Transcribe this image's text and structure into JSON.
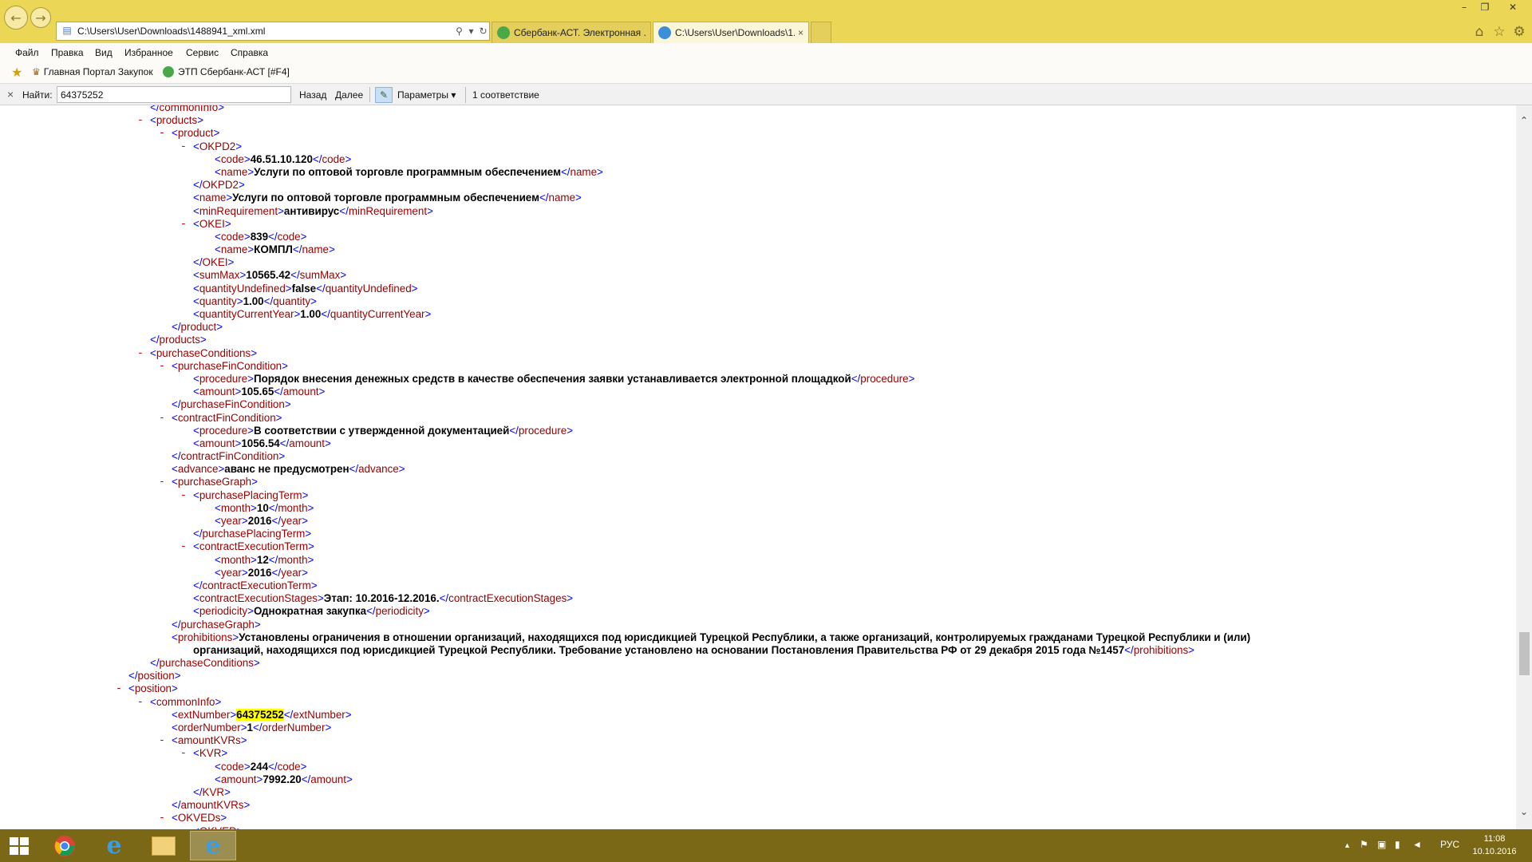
{
  "browser": {
    "address_url": "C:\\Users\\User\\Downloads\\1488941_xml.xml",
    "tabs": [
      {
        "label": "Сбербанк-АСТ. Электронная ...",
        "icon": "sberbank-icon"
      },
      {
        "label": "C:\\Users\\User\\Downloads\\1...",
        "icon": "ie-page-icon",
        "close": "×"
      }
    ],
    "window_controls": {
      "minimize": "–",
      "restore": "❐",
      "close": "✕"
    },
    "right_icons": [
      "home-icon",
      "favorites-star-icon",
      "gear-icon"
    ]
  },
  "menu": {
    "items": [
      "Файл",
      "Правка",
      "Вид",
      "Избранное",
      "Сервис",
      "Справка"
    ]
  },
  "favorites": {
    "items": [
      "Главная Портал Закупок",
      "ЭТП Сбербанк-АСТ [#F4]"
    ]
  },
  "find": {
    "close": "×",
    "label": "Найти:",
    "value": "64375252",
    "prev": "Назад",
    "next": "Далее",
    "options": "Параметры",
    "options_arrow": "▾",
    "result": "1 соответствие"
  },
  "highlight_text": "64375252",
  "xml_lines": [
    {
      "indent": 3,
      "type": "close",
      "tag": "commonInfo"
    },
    {
      "indent": 3,
      "type": "open",
      "tag": "products",
      "toggle": true
    },
    {
      "indent": 4,
      "type": "open",
      "tag": "product",
      "toggle": true
    },
    {
      "indent": 5,
      "type": "open",
      "tag": "OKPD2",
      "toggle": true
    },
    {
      "indent": 6,
      "type": "leaf",
      "tag": "code",
      "value": "46.51.10.120"
    },
    {
      "indent": 6,
      "type": "leaf",
      "tag": "name",
      "value": "Услуги по оптовой торговле программным обеспечением"
    },
    {
      "indent": 5,
      "type": "close",
      "tag": "OKPD2"
    },
    {
      "indent": 5,
      "type": "leaf",
      "tag": "name",
      "value": "Услуги по оптовой торговле программным обеспечением"
    },
    {
      "indent": 5,
      "type": "leaf",
      "tag": "minRequirement",
      "value": "антивирус"
    },
    {
      "indent": 5,
      "type": "open",
      "tag": "OKEI",
      "toggle": true
    },
    {
      "indent": 6,
      "type": "leaf",
      "tag": "code",
      "value": "839"
    },
    {
      "indent": 6,
      "type": "leaf",
      "tag": "name",
      "value": "КОМПЛ"
    },
    {
      "indent": 5,
      "type": "close",
      "tag": "OKEI"
    },
    {
      "indent": 5,
      "type": "leaf",
      "tag": "sumMax",
      "value": "10565.42"
    },
    {
      "indent": 5,
      "type": "leaf",
      "tag": "quantityUndefined",
      "value": "false"
    },
    {
      "indent": 5,
      "type": "leaf",
      "tag": "quantity",
      "value": "1.00"
    },
    {
      "indent": 5,
      "type": "leaf",
      "tag": "quantityCurrentYear",
      "value": "1.00"
    },
    {
      "indent": 4,
      "type": "close",
      "tag": "product"
    },
    {
      "indent": 3,
      "type": "close",
      "tag": "products"
    },
    {
      "indent": 3,
      "type": "open",
      "tag": "purchaseConditions",
      "toggle": true
    },
    {
      "indent": 4,
      "type": "open",
      "tag": "purchaseFinCondition",
      "toggle": true
    },
    {
      "indent": 5,
      "type": "leaf",
      "tag": "procedure",
      "value": "Порядок внесения денежных средств в качестве обеспечения заявки устанавливается электронной площадкой"
    },
    {
      "indent": 5,
      "type": "leaf",
      "tag": "amount",
      "value": "105.65"
    },
    {
      "indent": 4,
      "type": "close",
      "tag": "purchaseFinCondition"
    },
    {
      "indent": 4,
      "type": "open",
      "tag": "contractFinCondition",
      "toggle": true
    },
    {
      "indent": 5,
      "type": "leaf",
      "tag": "procedure",
      "value": "В соответствии с утвержденной документацией"
    },
    {
      "indent": 5,
      "type": "leaf",
      "tag": "amount",
      "value": "1056.54"
    },
    {
      "indent": 4,
      "type": "close",
      "tag": "contractFinCondition"
    },
    {
      "indent": 4,
      "type": "leaf",
      "tag": "advance",
      "value": "аванс не предусмотрен"
    },
    {
      "indent": 4,
      "type": "open",
      "tag": "purchaseGraph",
      "toggle": true
    },
    {
      "indent": 5,
      "type": "open",
      "tag": "purchasePlacingTerm",
      "toggle": true
    },
    {
      "indent": 6,
      "type": "leaf",
      "tag": "month",
      "value": "10"
    },
    {
      "indent": 6,
      "type": "leaf",
      "tag": "year",
      "value": "2016"
    },
    {
      "indent": 5,
      "type": "close",
      "tag": "purchasePlacingTerm"
    },
    {
      "indent": 5,
      "type": "open",
      "tag": "contractExecutionTerm",
      "toggle": true
    },
    {
      "indent": 6,
      "type": "leaf",
      "tag": "month",
      "value": "12"
    },
    {
      "indent": 6,
      "type": "leaf",
      "tag": "year",
      "value": "2016"
    },
    {
      "indent": 5,
      "type": "close",
      "tag": "contractExecutionTerm"
    },
    {
      "indent": 5,
      "type": "leaf",
      "tag": "contractExecutionStages",
      "value": "Этап: 10.2016-12.2016."
    },
    {
      "indent": 5,
      "type": "leaf",
      "tag": "periodicity",
      "value": "Однократная закупка"
    },
    {
      "indent": 4,
      "type": "close",
      "tag": "purchaseGraph"
    },
    {
      "indent": 4,
      "type": "leaf_start",
      "tag": "prohibitions",
      "value": "Установлены ограничения в отношении организаций, находящихся под юрисдикцией Турецкой Республики, а также организаций, контролируемых гражданами Турецкой Республики и (или)"
    },
    {
      "indent": 5,
      "type": "leaf_end",
      "tag": "prohibitions",
      "value": "организаций, находящихся под юрисдикцией Турецкой Республики. Требование установлено на основании Постановления Правительства РФ от 29 декабря 2015 года №1457"
    },
    {
      "indent": 3,
      "type": "close",
      "tag": "purchaseConditions"
    },
    {
      "indent": 2,
      "type": "close",
      "tag": "position"
    },
    {
      "indent": 2,
      "type": "open",
      "tag": "position",
      "toggle": true
    },
    {
      "indent": 3,
      "type": "open",
      "tag": "commonInfo",
      "toggle": true
    },
    {
      "indent": 4,
      "type": "leaf",
      "tag": "extNumber",
      "value": "64375252",
      "highlight": true
    },
    {
      "indent": 4,
      "type": "leaf",
      "tag": "orderNumber",
      "value": "1"
    },
    {
      "indent": 4,
      "type": "open",
      "tag": "amountKVRs",
      "toggle": true
    },
    {
      "indent": 5,
      "type": "open",
      "tag": "KVR",
      "toggle": true
    },
    {
      "indent": 6,
      "type": "leaf",
      "tag": "code",
      "value": "244"
    },
    {
      "indent": 6,
      "type": "leaf",
      "tag": "amount",
      "value": "7992.20"
    },
    {
      "indent": 5,
      "type": "close",
      "tag": "KVR"
    },
    {
      "indent": 4,
      "type": "close",
      "tag": "amountKVRs"
    },
    {
      "indent": 4,
      "type": "open",
      "tag": "OKVEDs",
      "toggle": true
    },
    {
      "indent": 5,
      "type": "open",
      "tag": "OKVED",
      "toggle": true
    }
  ],
  "scrollbar": {
    "up": "⌃",
    "down": "⌄"
  },
  "taskbar": {
    "apps": [
      "start-button",
      "chrome-icon",
      "ie-icon",
      "file-explorer-icon",
      "ie-active-icon"
    ],
    "tray_lang": "РУС",
    "tray_arrow": "▲",
    "time": "11:08",
    "date": "10.10.2016"
  },
  "colors": {
    "titlebar": "#ecd655",
    "taskbar": "#7a6816",
    "xml_markup": "#0000ff",
    "xml_tag": "#990000",
    "toggle": "#d00000",
    "highlight": "#ffff00"
  }
}
